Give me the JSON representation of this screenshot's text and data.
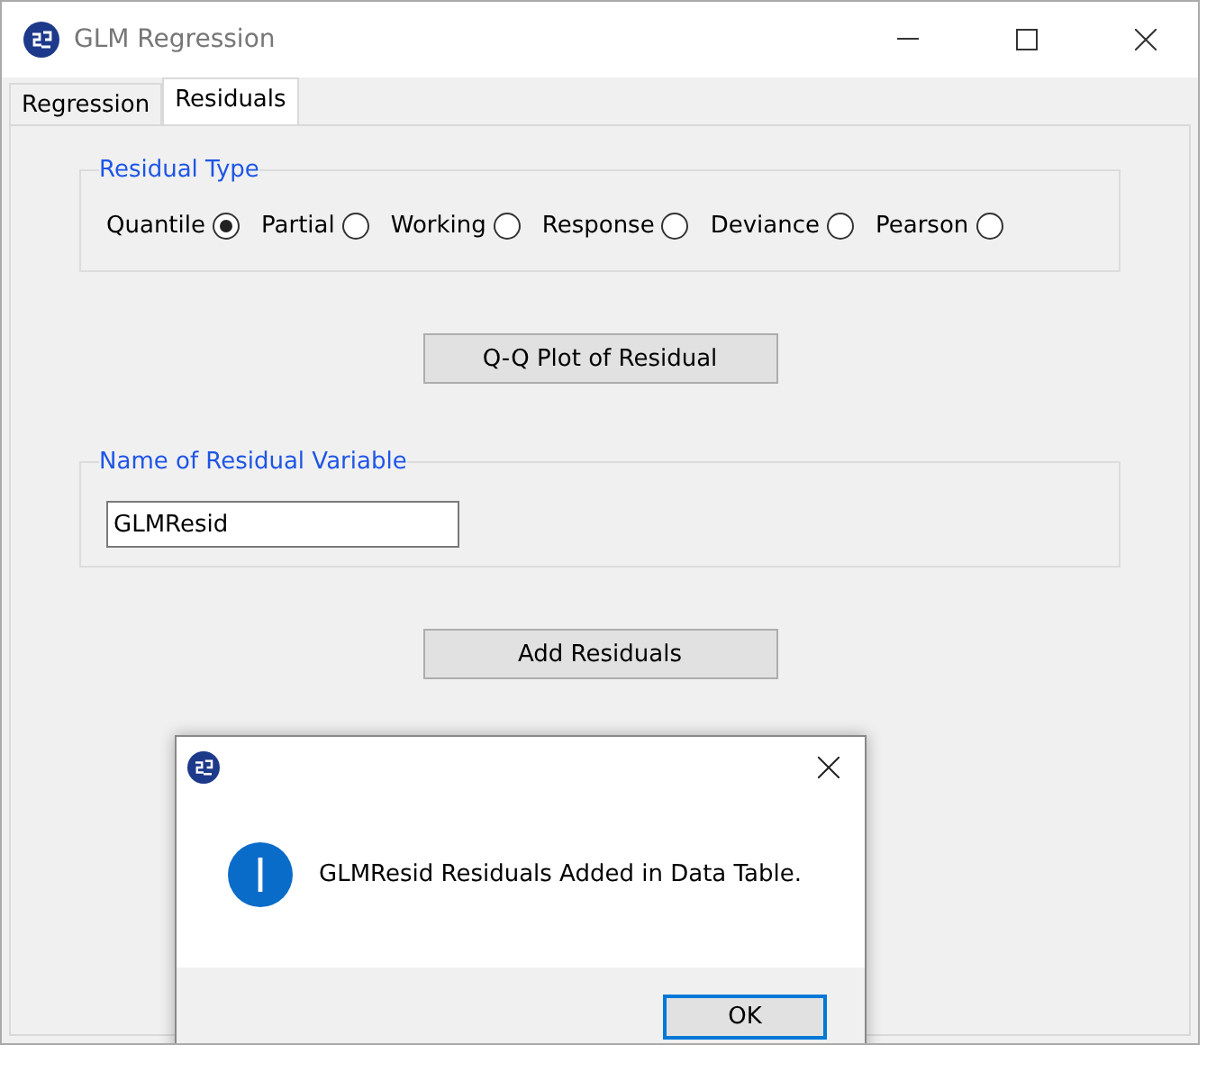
{
  "window": {
    "title": "GLM Regression"
  },
  "tabs": [
    {
      "label": "Regression",
      "selected": false
    },
    {
      "label": "Residuals",
      "selected": true
    }
  ],
  "residual_type": {
    "legend": "Residual Type",
    "options": [
      {
        "label": "Quantile",
        "selected": true
      },
      {
        "label": "Partial",
        "selected": false
      },
      {
        "label": "Working",
        "selected": false
      },
      {
        "label": "Response",
        "selected": false
      },
      {
        "label": "Deviance",
        "selected": false
      },
      {
        "label": "Pearson",
        "selected": false
      }
    ]
  },
  "qq_button": "Q-Q Plot of Residual",
  "residual_name": {
    "legend": "Name of Residual Variable",
    "value": "GLMResid"
  },
  "add_button": "Add Residuals",
  "dialog": {
    "message": "GLMResid Residuals Added in Data Table.",
    "ok_button": "OK"
  }
}
